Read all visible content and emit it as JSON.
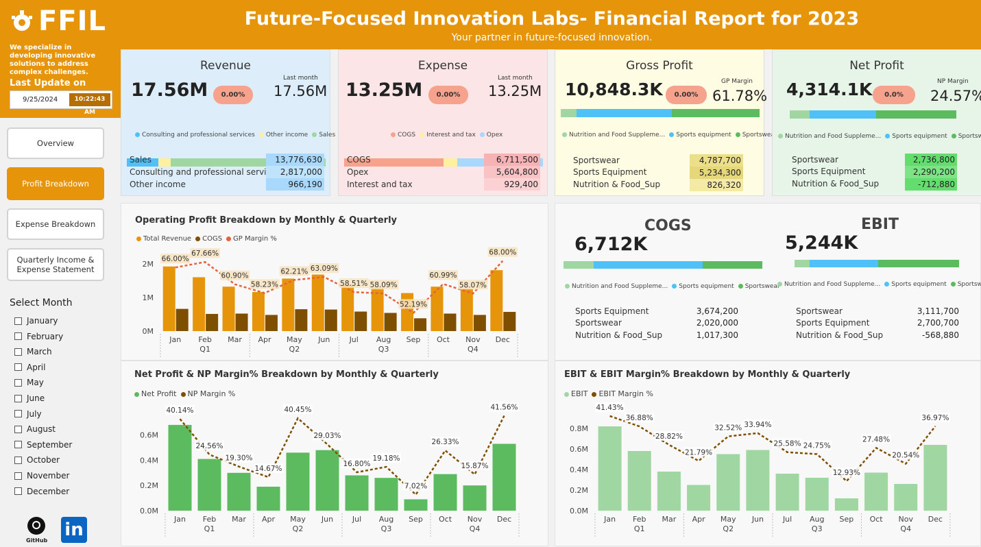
{
  "brand": {
    "logo_text": "FFIL",
    "tagline": "We specialize in developing innovative solutions to address complex challenges.",
    "last_update_label": "Last Update on",
    "date": "9/25/2024",
    "time": "10:22:43 AM",
    "accent": "#e6950a"
  },
  "header": {
    "title": "Future-Focused Innovation Labs- Financial Report for 2023",
    "subtitle": "Your partner in future-focused innovation."
  },
  "nav": {
    "overview": "Overview",
    "profit": "Profit Breakdown",
    "expense": "Expense Breakdown",
    "quarterly_line1": "Quarterly Income &",
    "quarterly_line2": "Expense Statement"
  },
  "filter": {
    "label": "Select Month",
    "months": [
      "January",
      "February",
      "March",
      "April",
      "May",
      "June",
      "July",
      "August",
      "September",
      "October",
      "November",
      "December"
    ]
  },
  "social": {
    "github": "GitHub",
    "linkedin": "in"
  },
  "kpis": {
    "revenue": {
      "title": "Revenue",
      "value": "17.56M",
      "pill": "0.00%",
      "lm_label": "Last month",
      "lm_value": "17.56M",
      "legend": [
        "Consulting and professional services",
        "Other income",
        "Sales"
      ],
      "rows": [
        [
          "Sales",
          "13,776,630"
        ],
        [
          "Consulting and professional services",
          "2,817,000"
        ],
        [
          "Other income",
          "966,190"
        ]
      ]
    },
    "expense": {
      "title": "Expense",
      "value": "13.25M",
      "pill": "0.00%",
      "lm_label": "Last month",
      "lm_value": "13.25M",
      "legend": [
        "COGS",
        "Interest and tax",
        "Opex"
      ],
      "rows": [
        [
          "COGS",
          "6,711,500"
        ],
        [
          "Opex",
          "5,604,800"
        ],
        [
          "Interest and tax",
          "929,400"
        ]
      ]
    },
    "gross": {
      "title": "Gross Profit",
      "value": "10,848.3K",
      "pill": "0.00%",
      "lm_label": "GP Margin",
      "lm_value": "61.78%",
      "legend": [
        "Nutrition and Food Suppleme...",
        "Sports equipment",
        "Sportswear"
      ],
      "rows": [
        [
          "Sportswear",
          "4,787,700"
        ],
        [
          "Sports Equipment",
          "5,234,300"
        ],
        [
          "Nutrition & Food_Sup",
          "826,320"
        ]
      ]
    },
    "net": {
      "title": "Net Profit",
      "value": "4,314.1K",
      "pill": "0.0%",
      "lm_label": "NP Margin",
      "lm_value": "24.57%",
      "legend": [
        "Nutrition and Food Suppleme...",
        "Sports equipment",
        "Sportswear"
      ],
      "rows": [
        [
          "Sportswear",
          "2,736,800"
        ],
        [
          "Sports Equipment",
          "2,290,200"
        ],
        [
          "Nutrition & Food_Sup",
          "-712,880"
        ]
      ]
    }
  },
  "cogs_card": {
    "title": "COGS",
    "value": "6,712K",
    "legend": [
      "Nutrition and Food Suppleme...",
      "Sports equipment",
      "Sportswear"
    ],
    "rows": [
      [
        "Sports Equipment",
        "3,674,200"
      ],
      [
        "Sportswear",
        "2,020,000"
      ],
      [
        "Nutrition & Food_Sup",
        "1,017,300"
      ]
    ]
  },
  "ebit_card": {
    "title": "EBIT",
    "value": "5,244K",
    "legend": [
      "Nutrition and Food Suppleme...",
      "Sports equipment",
      "Sportswear"
    ],
    "rows": [
      [
        "Sportswear",
        "3,111,700"
      ],
      [
        "Sports Equipment",
        "2,700,700"
      ],
      [
        "Nutrition & Food_Sup",
        "-568,880"
      ]
    ]
  },
  "colors": {
    "revenue_bg": "#ddeefa",
    "expense_bg": "#fbe5e6",
    "gross_bg": "#fefde4",
    "net_bg": "#e7f5e8",
    "blue": "#4fc1f7",
    "yellow": "#fdf09e",
    "green_light": "#a0d6a2",
    "green": "#5cba5f",
    "salmon": "#f7a28c",
    "orange": "#e6950a",
    "brown": "#7f4f00"
  },
  "chart_data": [
    {
      "type": "bar",
      "title": "Operating Profit Breakdown by Monthly & Quarterly",
      "categories": [
        "Jan",
        "Feb",
        "Mar",
        "Apr",
        "May",
        "Jun",
        "Jul",
        "Aug",
        "Sep",
        "Oct",
        "Nov",
        "Dec"
      ],
      "quarters": [
        "Q1",
        "Q2",
        "Q3",
        "Q4"
      ],
      "yticks": [
        "0M",
        "1M",
        "2M"
      ],
      "ylim": [
        0,
        2200000
      ],
      "series": [
        {
          "name": "Total Revenue",
          "values": [
            1920000,
            1600000,
            1320000,
            1160000,
            1560000,
            1680000,
            1380000,
            1290000,
            1130000,
            1320000,
            1260000,
            1810000
          ]
        },
        {
          "name": "COGS",
          "values": [
            660000,
            510000,
            520000,
            480000,
            650000,
            640000,
            580000,
            540000,
            380000,
            520000,
            480000,
            570000
          ]
        },
        {
          "name": "GP Margin %",
          "values": [
            66.0,
            67.66,
            60.9,
            58.23,
            62.21,
            63.09,
            58.51,
            58.09,
            52.19,
            60.99,
            58.07,
            68.0
          ],
          "labels": [
            "66.00%",
            "67.66%",
            "60.90%",
            "58.23%",
            "62.21%",
            "63.09%",
            "58.51%",
            "58.09%",
            "52.19%",
            "60.99%",
            "58.07%",
            "68.00%"
          ]
        }
      ],
      "grid": false,
      "legend": "top-left"
    },
    {
      "type": "bar",
      "title": "Net Profit & NP Margin% Breakdown by Monthly & Quarterly",
      "categories": [
        "Jan",
        "Feb",
        "Mar",
        "Apr",
        "May",
        "Jun",
        "Jul",
        "Aug",
        "Sep",
        "Oct",
        "Nov",
        "Dec"
      ],
      "quarters": [
        "Q1",
        "Q2",
        "Q3",
        "Q4"
      ],
      "yticks": [
        "0.0M",
        "0.2M",
        "0.4M",
        "0.6M"
      ],
      "ylim": [
        0,
        0.75
      ],
      "series": [
        {
          "name": "Net Profit",
          "values": [
            0.68,
            0.41,
            0.3,
            0.19,
            0.46,
            0.48,
            0.28,
            0.26,
            0.09,
            0.29,
            0.2,
            0.53
          ]
        },
        {
          "name": "NP Margin %",
          "values": [
            40.14,
            24.56,
            19.3,
            14.67,
            40.45,
            29.03,
            16.8,
            19.18,
            7.02,
            26.33,
            15.87,
            41.56
          ],
          "labels": [
            "40.14%",
            "24.56%",
            "19.30%",
            "14.67%",
            "40.45%",
            "29.03%",
            "16.80%",
            "19.18%",
            "7.02%",
            "26.33%",
            "15.87%",
            "41.56%"
          ]
        }
      ],
      "grid": false,
      "legend": "top-left"
    },
    {
      "type": "bar",
      "title": "EBIT & EBIT Margin% Breakdown by Monthly & Quarterly",
      "categories": [
        "Jan",
        "Feb",
        "Mar",
        "Apr",
        "May",
        "Jun",
        "Jul",
        "Aug",
        "Sep",
        "Oct",
        "Nov",
        "Dec"
      ],
      "quarters": [
        "Q1",
        "Q2",
        "Q3",
        "Q4"
      ],
      "yticks": [
        "0.0M",
        "0.2M",
        "0.4M",
        "0.6M",
        "0.8M"
      ],
      "ylim": [
        0,
        0.92
      ],
      "series": [
        {
          "name": "EBIT",
          "values": [
            0.82,
            0.58,
            0.38,
            0.25,
            0.55,
            0.59,
            0.36,
            0.32,
            0.12,
            0.37,
            0.26,
            0.64
          ]
        },
        {
          "name": "EBIT Margin %",
          "values": [
            41.43,
            36.88,
            28.82,
            21.79,
            32.52,
            33.94,
            25.58,
            24.75,
            12.93,
            27.48,
            20.54,
            36.97
          ],
          "labels": [
            "41.43%",
            "36.88%",
            "28.82%",
            "21.79%",
            "32.52%",
            "33.94%",
            "25.58%",
            "24.75%",
            "12.93%",
            "27.48%",
            "20.54%",
            "36.97%"
          ]
        }
      ],
      "grid": false,
      "legend": "top-left"
    }
  ]
}
